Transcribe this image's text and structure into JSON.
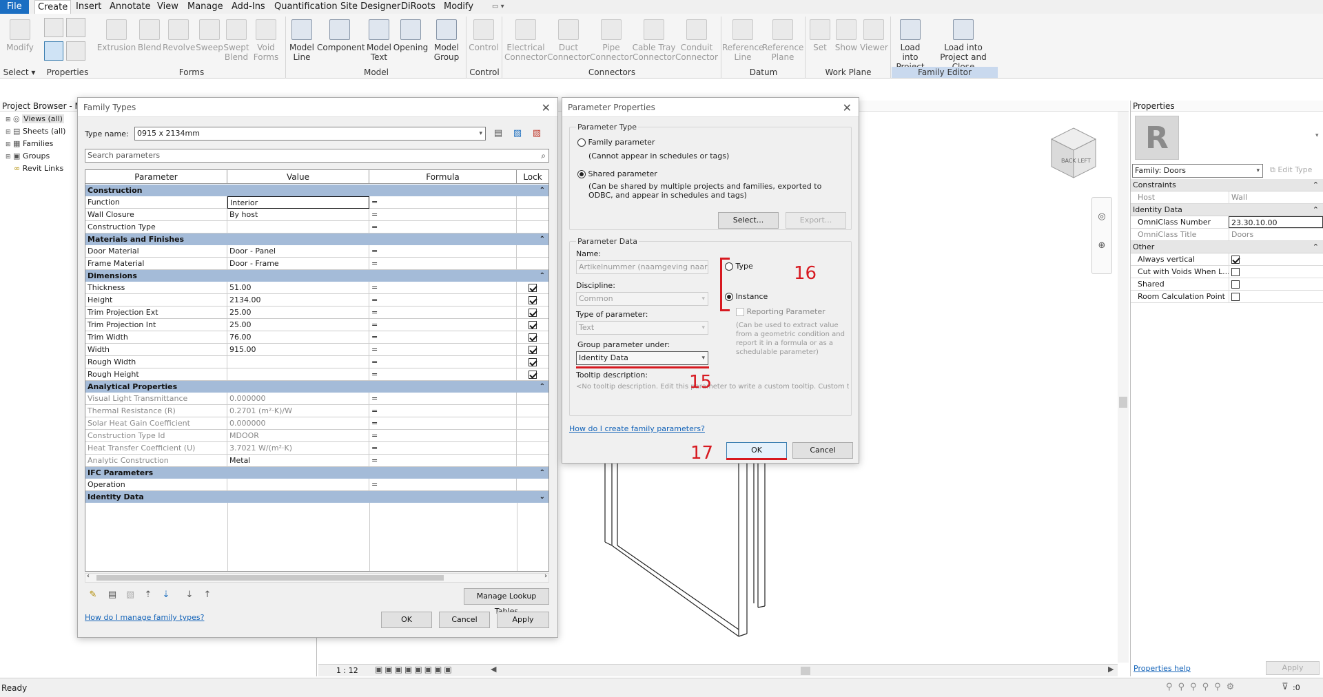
{
  "ribbon": {
    "tabs": [
      "File",
      "Create",
      "Insert",
      "Annotate",
      "View",
      "Manage",
      "Add-Ins",
      "Quantification",
      "Site Designer",
      "DiRoots",
      "Modify"
    ],
    "active_tab": "Create",
    "buttons": {
      "modify": "Modify",
      "extrusion": "Extrusion",
      "blend": "Blend",
      "revolve": "Revolve",
      "sweep": "Sweep",
      "swept_blend_1": "Swept",
      "swept_blend_2": "Blend",
      "void_forms_1": "Void",
      "void_forms_2": "Forms",
      "model_line_1": "Model",
      "model_line_2": "Line",
      "component": "Component",
      "model_text_1": "Model",
      "model_text_2": "Text",
      "opening": "Opening",
      "model_group_1": "Model",
      "model_group_2": "Group",
      "control": "Control",
      "elec_conn_1": "Electrical",
      "elec_conn_2": "Connector",
      "duct_conn_1": "Duct",
      "duct_conn_2": "Connector",
      "pipe_conn_1": "Pipe",
      "pipe_conn_2": "Connector",
      "cable_conn_1": "Cable Tray",
      "cable_conn_2": "Connector",
      "conduit_conn_1": "Conduit",
      "conduit_conn_2": "Connector",
      "ref_line_1": "Reference",
      "ref_line_2": "Line",
      "ref_plane_1": "Reference",
      "ref_plane_2": "Plane",
      "set": "Set",
      "show": "Show",
      "viewer": "Viewer",
      "load_project_1": "Load into",
      "load_project_2": "Project",
      "load_close_1": "Load into",
      "load_close_2": "Project and Close"
    },
    "panels": {
      "select": "Select",
      "properties": "Properties",
      "forms": "Forms",
      "model": "Model",
      "control": "Control",
      "connectors": "Connectors",
      "datum": "Datum",
      "work_plane": "Work Plane",
      "family_editor": "Family Editor"
    }
  },
  "project_browser": {
    "title": "Project Browser - M",
    "items": [
      "Views (all)",
      "Sheets (all)",
      "Families",
      "Groups",
      "Revit Links"
    ]
  },
  "family_types": {
    "title": "Family Types",
    "type_name_label": "Type name:",
    "type_name_value": "0915 x 2134mm",
    "search_placeholder": "Search parameters",
    "columns": {
      "parameter": "Parameter",
      "value": "Value",
      "formula": "Formula",
      "lock": "Lock"
    },
    "groups": {
      "construction": "Construction",
      "materials": "Materials and Finishes",
      "dimensions": "Dimensions",
      "analytical": "Analytical Properties",
      "ifc": "IFC Parameters",
      "identity": "Identity Data"
    },
    "construction_rows": [
      {
        "p": "Function",
        "v": "Interior",
        "f": "="
      },
      {
        "p": "Wall Closure",
        "v": "By host",
        "f": "="
      },
      {
        "p": "Construction Type",
        "v": "",
        "f": "="
      }
    ],
    "materials_rows": [
      {
        "p": "Door Material",
        "v": "Door - Panel",
        "f": "="
      },
      {
        "p": "Frame Material",
        "v": "Door - Frame",
        "f": "="
      }
    ],
    "dimension_rows": [
      {
        "p": "Thickness",
        "v": "51.00",
        "f": "="
      },
      {
        "p": "Height",
        "v": "2134.00",
        "f": "="
      },
      {
        "p": "Trim Projection Ext",
        "v": "25.00",
        "f": "="
      },
      {
        "p": "Trim Projection Int",
        "v": "25.00",
        "f": "="
      },
      {
        "p": "Trim Width",
        "v": "76.00",
        "f": "="
      },
      {
        "p": "Width",
        "v": "915.00",
        "f": "="
      },
      {
        "p": "Rough Width",
        "v": "",
        "f": "="
      },
      {
        "p": "Rough Height",
        "v": "",
        "f": "="
      }
    ],
    "analytical_rows": [
      {
        "p": "Visual Light Transmittance",
        "v": "0.000000",
        "f": "="
      },
      {
        "p": "Thermal Resistance (R)",
        "v": "0.2701 (m²·K)/W",
        "f": "="
      },
      {
        "p": "Solar Heat Gain Coefficient",
        "v": "0.000000",
        "f": "="
      },
      {
        "p": "Construction Type Id",
        "v": "MDOOR",
        "f": "="
      },
      {
        "p": "Heat Transfer Coefficient (U)",
        "v": "3.7021 W/(m²·K)",
        "f": "="
      },
      {
        "p": "Analytic Construction",
        "v": "Metal",
        "f": "="
      }
    ],
    "ifc_rows": [
      {
        "p": "Operation",
        "v": "",
        "f": "="
      }
    ],
    "manage_lookup": "Manage Lookup Tables",
    "help_link": "How do I manage family types?",
    "ok": "OK",
    "cancel": "Cancel",
    "apply": "Apply"
  },
  "param_props": {
    "title": "Parameter Properties",
    "param_type_legend": "Parameter Type",
    "family_param": "Family parameter",
    "family_param_note": "(Cannot appear in schedules or tags)",
    "shared_param": "Shared parameter",
    "shared_param_note": "(Can be shared by multiple projects and families, exported to ODBC, and appear in schedules and tags)",
    "select_btn": "Select...",
    "export_btn": "Export...",
    "param_data_legend": "Parameter Data",
    "name_label": "Name:",
    "name_value": "Artikelnummer (naamgeving naar keuz",
    "discipline_label": "Discipline:",
    "discipline_value": "Common",
    "type_of_param_label": "Type of parameter:",
    "type_of_param_value": "Text",
    "group_under_label": "Group parameter under:",
    "group_under_value": "Identity Data",
    "tooltip_label": "Tooltip description:",
    "tooltip_value": "<No tooltip description. Edit this parameter to write a custom tooltip. Custom t...",
    "type_radio": "Type",
    "instance_radio": "Instance",
    "reporting_param": "Reporting Parameter",
    "reporting_note": "(Can be used to extract value from a geometric condition and report it in a formula or as a schedulable parameter)",
    "help_link": "How do I create family parameters?",
    "ok": "OK",
    "cancel": "Cancel"
  },
  "annotations": {
    "a15": "15",
    "a16": "16",
    "a17": "17"
  },
  "view": {
    "scale": "1 : 12"
  },
  "properties_panel": {
    "title": "Properties",
    "family_selector": "Family: Doors",
    "edit_type": "Edit Type",
    "groups": {
      "constraints": "Constraints",
      "identity": "Identity Data",
      "other": "Other"
    },
    "host_label": "Host",
    "host_value": "Wall",
    "omniclass_number_label": "OmniClass Number",
    "omniclass_number_value": "23.30.10.00",
    "omniclass_title_label": "OmniClass Title",
    "omniclass_title_value": "Doors",
    "always_vertical": "Always vertical",
    "cut_with_voids": "Cut with Voids When L...",
    "shared": "Shared",
    "room_calc": "Room Calculation Point",
    "help_link": "Properties help",
    "apply": "Apply"
  },
  "status": {
    "text": "Ready",
    "filter_count": ":0"
  }
}
